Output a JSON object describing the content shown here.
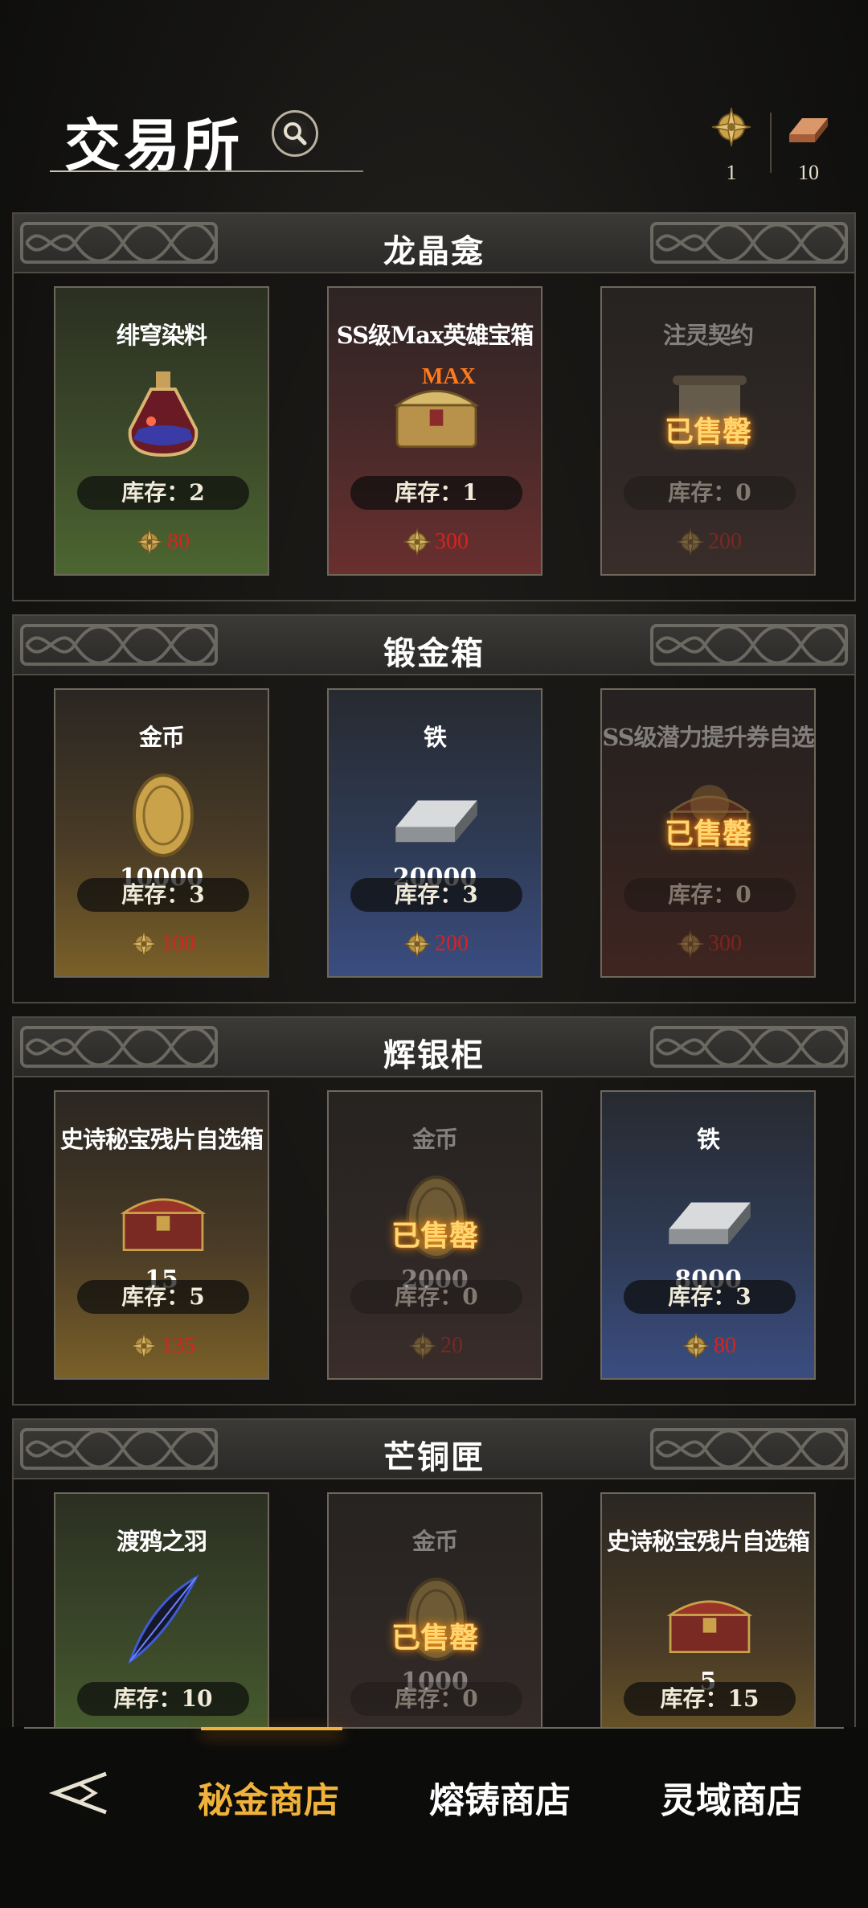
{
  "header": {
    "title": "交易所",
    "currencies": [
      {
        "icon": "compass-coin-icon",
        "value": "1"
      },
      {
        "icon": "copper-ingot-icon",
        "value": "10"
      }
    ]
  },
  "sections": [
    {
      "title": "龙晶龛",
      "cards": [
        {
          "name": "绯穹染料",
          "icon": "potion-icon",
          "bg": "green",
          "qty": "",
          "stock": "库存：2",
          "price": "80",
          "sold": ""
        },
        {
          "name": "SS级Max英雄宝箱",
          "icon": "gold-chest-icon",
          "bg": "red",
          "qty": "",
          "tag": "MAX",
          "stock": "库存：1",
          "price": "300",
          "sold": ""
        },
        {
          "name": "注灵契约",
          "icon": "scroll-icon",
          "bg": "dark",
          "qty": "",
          "stock": "库存：0",
          "price": "200",
          "sold": "已售罄"
        }
      ]
    },
    {
      "title": "锻金箱",
      "cards": [
        {
          "name": "金币",
          "icon": "gold-coin-icon",
          "bg": "gold",
          "qty": "10000",
          "stock": "库存：3",
          "price": "100",
          "sold": ""
        },
        {
          "name": "铁",
          "icon": "iron-ingot-icon",
          "bg": "blue",
          "qty": "20000",
          "stock": "库存：3",
          "price": "200",
          "sold": ""
        },
        {
          "name": "SS级潜力提升券自选",
          "icon": "treasure-chest-icon",
          "bg": "darkred",
          "qty": "",
          "stock": "库存：0",
          "price": "300",
          "sold": "已售罄"
        }
      ]
    },
    {
      "title": "辉银柜",
      "cards": [
        {
          "name": "史诗秘宝残片自选箱",
          "icon": "red-chest-icon",
          "bg": "gold",
          "qty": "15",
          "stock": "库存：5",
          "price": "135",
          "sold": ""
        },
        {
          "name": "金币",
          "icon": "gold-coin-icon",
          "bg": "dark",
          "qty": "2000",
          "stock": "库存：0",
          "price": "20",
          "sold": "已售罄"
        },
        {
          "name": "铁",
          "icon": "iron-ingot-icon",
          "bg": "blue",
          "qty": "8000",
          "stock": "库存：3",
          "price": "80",
          "sold": ""
        }
      ]
    },
    {
      "title": "芒铜匣",
      "cards": [
        {
          "name": "渡鸦之羽",
          "icon": "feather-icon",
          "bg": "green",
          "qty": "",
          "stock": "库存：10",
          "price": "",
          "sold": ""
        },
        {
          "name": "金币",
          "icon": "gold-coin-icon",
          "bg": "dark",
          "qty": "1000",
          "stock": "库存：0",
          "price": "",
          "sold": "已售罄"
        },
        {
          "name": "史诗秘宝残片自选箱",
          "icon": "red-chest-icon",
          "bg": "gold",
          "qty": "5",
          "stock": "库存：15",
          "price": "",
          "sold": ""
        }
      ]
    }
  ],
  "nav": {
    "tabs": [
      "秘金商店",
      "熔铸商店",
      "灵域商店"
    ],
    "active_index": 0
  },
  "colors": {
    "accent": "#f0b23a",
    "price": "#d8231f",
    "sold_out": "#ffd772"
  }
}
